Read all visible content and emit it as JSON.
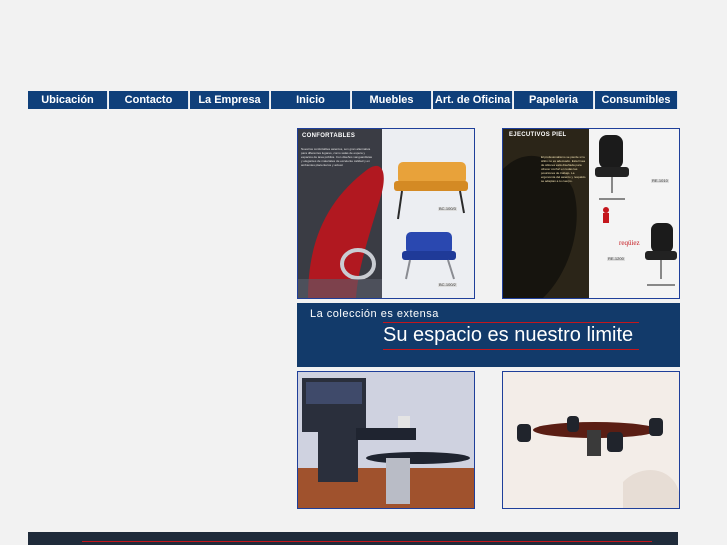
{
  "nav": {
    "items": [
      {
        "label": "Ubicación"
      },
      {
        "label": "Contacto"
      },
      {
        "label": "La Empresa"
      },
      {
        "label": "Inicio"
      },
      {
        "label": "Muebles"
      },
      {
        "label": "Art. de Oficina"
      },
      {
        "label": "Papeleria"
      },
      {
        "label": "Consumibles"
      }
    ]
  },
  "panels": {
    "confortables": {
      "title": "CONFORTABLES",
      "body": "Nuestros confortables asientos, son gran alternativa para diferentes lugares, como salas de espera y espacios de área pública. Con diseños vanguardistas y elegantes de materiales de excelente calidad y en ambientes placenteros y actual.",
      "tag1": "BC-100/3",
      "tag2": "BC-100/2"
    },
    "ejecutivos": {
      "title": "EJECUTIVOS PIEL",
      "body": "El profesionalismo se pierde si tu sillón no es adecuado. Esta línea de sillones está diseñada para ofrecer confort en todas las posiciones de trabajo. La ergonomía del asiento y respaldo se adaptan a tu cuerpo.",
      "brand": "reqüiez",
      "tag1": "RE-1010",
      "tag2": "RE-1200"
    }
  },
  "banner": {
    "subtitle": "La colección es extensa",
    "title": "Su espacio es nuestro limite"
  },
  "colors": {
    "nav_bg": "#0f3f7a",
    "banner_bg": "#123a6a",
    "accent_red": "#c4161c",
    "panel_border": "#1f3f9a"
  }
}
